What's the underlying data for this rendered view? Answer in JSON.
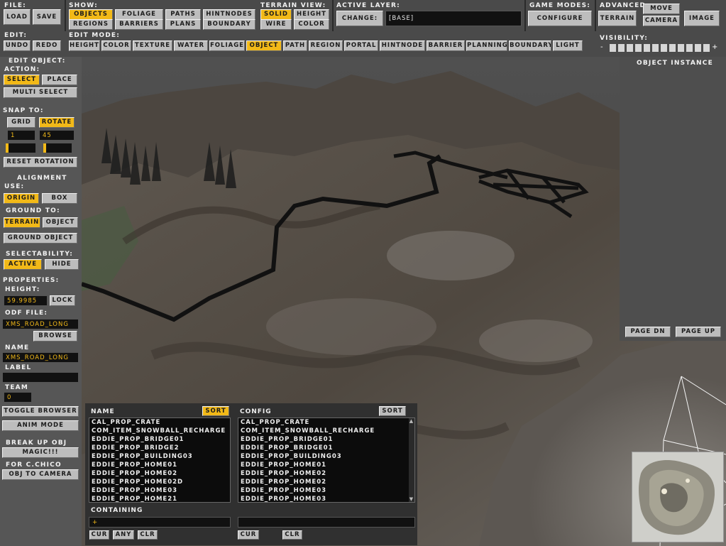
{
  "top": {
    "file_label": "File:",
    "load": "Load",
    "save": "Save",
    "show_label": "Show:",
    "show_items": [
      "Objects",
      "Foliage",
      "Paths",
      "HintNodes",
      "Regions",
      "Barriers",
      "Plans",
      "Boundary"
    ],
    "terrain_view_label": "Terrain View:",
    "terrain_view_items": [
      "Solid",
      "Height",
      "Wire",
      "Color"
    ],
    "active_layer_label": "Active Layer:",
    "change": "Change:",
    "active_layer_value": "[Base]",
    "game_modes_label": "Game Modes:",
    "configure": "Configure",
    "advanced_label": "Advanced",
    "terrain": "Terrain",
    "move": "Move",
    "camera": "Camera",
    "image": "Image",
    "edit_label": "Edit:",
    "undo": "Undo",
    "redo": "Redo",
    "edit_mode_label": "Edit Mode:",
    "edit_modes": [
      "Height",
      "Color",
      "Texture",
      "Water",
      "Foliage",
      "Object",
      "Path",
      "Region",
      "Portal",
      "HintNode",
      "Barrier",
      "Planning",
      "Boundary",
      "Light"
    ],
    "visibility_label": "Visibility:",
    "visibility_minus": "-",
    "visibility_plus": "+"
  },
  "left": {
    "edit_object": "Edit Object:",
    "action": "Action:",
    "select": "Select",
    "place": "Place",
    "multi_select": "Multi Select",
    "snap_to": "Snap To:",
    "grid": "Grid",
    "rotate": "Rotate",
    "grid_value": "1",
    "rotate_value": "45",
    "reset_rotation": "Reset Rotation",
    "alignment": "Alignment",
    "use": "Use:",
    "origin": "Origin",
    "box": "Box",
    "ground_to": "Ground To:",
    "terrain": "Terrain",
    "object": "Object",
    "ground_object": "Ground Object",
    "selectability": "Selectability:",
    "active": "Active",
    "hide": "Hide",
    "properties": "Properties:",
    "height_label": "Height:",
    "height_value": "59.9985",
    "lock": "Lock",
    "odf_file": "Odf File:",
    "odf_value": "xms_road_long",
    "browse": "Browse",
    "name_label": "Name",
    "name_value": "xms_road_long",
    "label_label": "Label",
    "label_value": "",
    "team_label": "Team",
    "team_value": "0",
    "toggle_browser": "Toggle Browser",
    "anim_mode": "Anim Mode",
    "break_up_obj": "Break Up Obj",
    "magic": "Magic!!!",
    "for_c_chico": "For C.Chico",
    "obj_to_camera": "Obj To Camera"
  },
  "right": {
    "object_instance": "Object Instance",
    "page_dn": "Page Dn",
    "page_up": "Page Up"
  },
  "browser": {
    "name_header": "Name",
    "config_header": "Config",
    "sort": "Sort",
    "items": [
      "cal_prop_crate",
      "com_item_snowball_recharge",
      "Eddie_Prop_Bridge01",
      "Eddie_Prop_Bridge2",
      "Eddie_Prop_Building03",
      "Eddie_Prop_Home01",
      "Eddie_Prop_Home02",
      "Eddie_Prop_Home02d",
      "Eddie_Prop_Home03",
      "Eddie_Prop_Home21"
    ],
    "config_items": [
      "cal_prop_crate",
      "com_item_snowball_recharge",
      "Eddie_Prop_Bridge01",
      "Eddie_Prop_Bridge01",
      "Eddie_Prop_Building03",
      "Eddie_Prop_Home01",
      "Eddie_Prop_Home02",
      "Eddie_Prop_Home02",
      "Eddie_Prop_Home03",
      "Eddie_Prop_Home03"
    ],
    "containing_label": "Containing",
    "containing_value": "+",
    "cur": "Cur",
    "any": "Any",
    "clr": "Clr"
  },
  "colors": {
    "accent": "#f2b918",
    "button": "#bdbdbd",
    "panel": "#565656"
  }
}
